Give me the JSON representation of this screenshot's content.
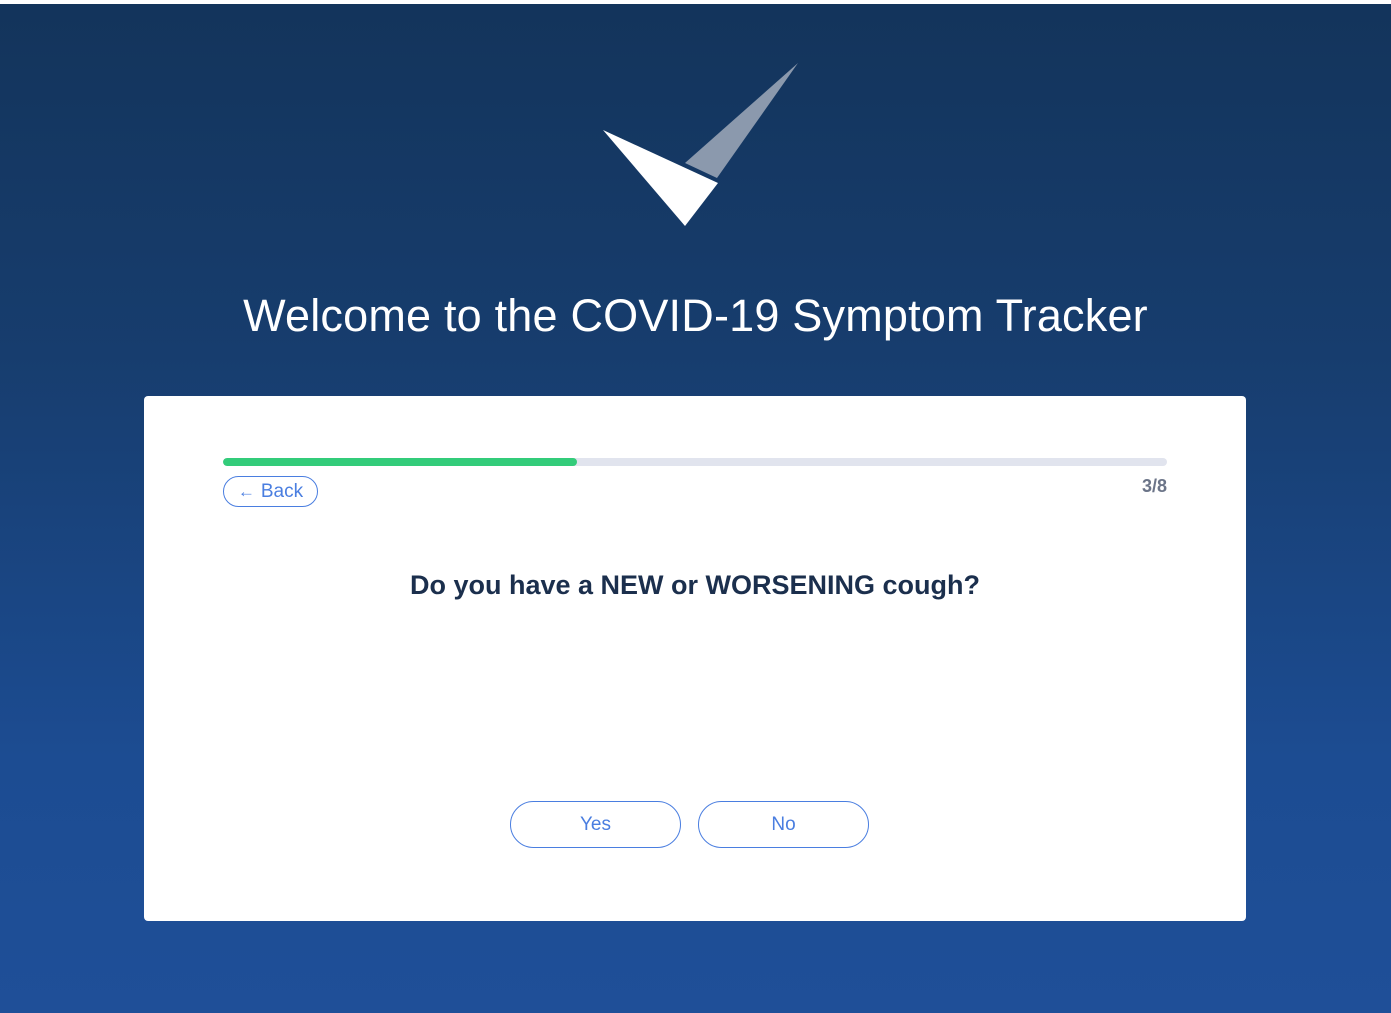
{
  "header": {
    "title": "Welcome to the COVID-19 Symptom Tracker",
    "logo_icon": "checkmark-logo-icon"
  },
  "card": {
    "progress": {
      "current": 3,
      "total": 8,
      "fraction": 0.375,
      "label": "3/8",
      "fill_color": "#33cc7a",
      "track_color": "#e1e4ee"
    },
    "back_button": {
      "arrow": "←",
      "label": "Back"
    },
    "question": "Do you have a NEW or WORSENING cough?",
    "answers": {
      "yes_label": "Yes",
      "no_label": "No"
    }
  },
  "colors": {
    "background_top": "#13345b",
    "background_bottom": "#1f4f98",
    "accent": "#4a7ee0",
    "question_text": "#1b2f4d"
  }
}
